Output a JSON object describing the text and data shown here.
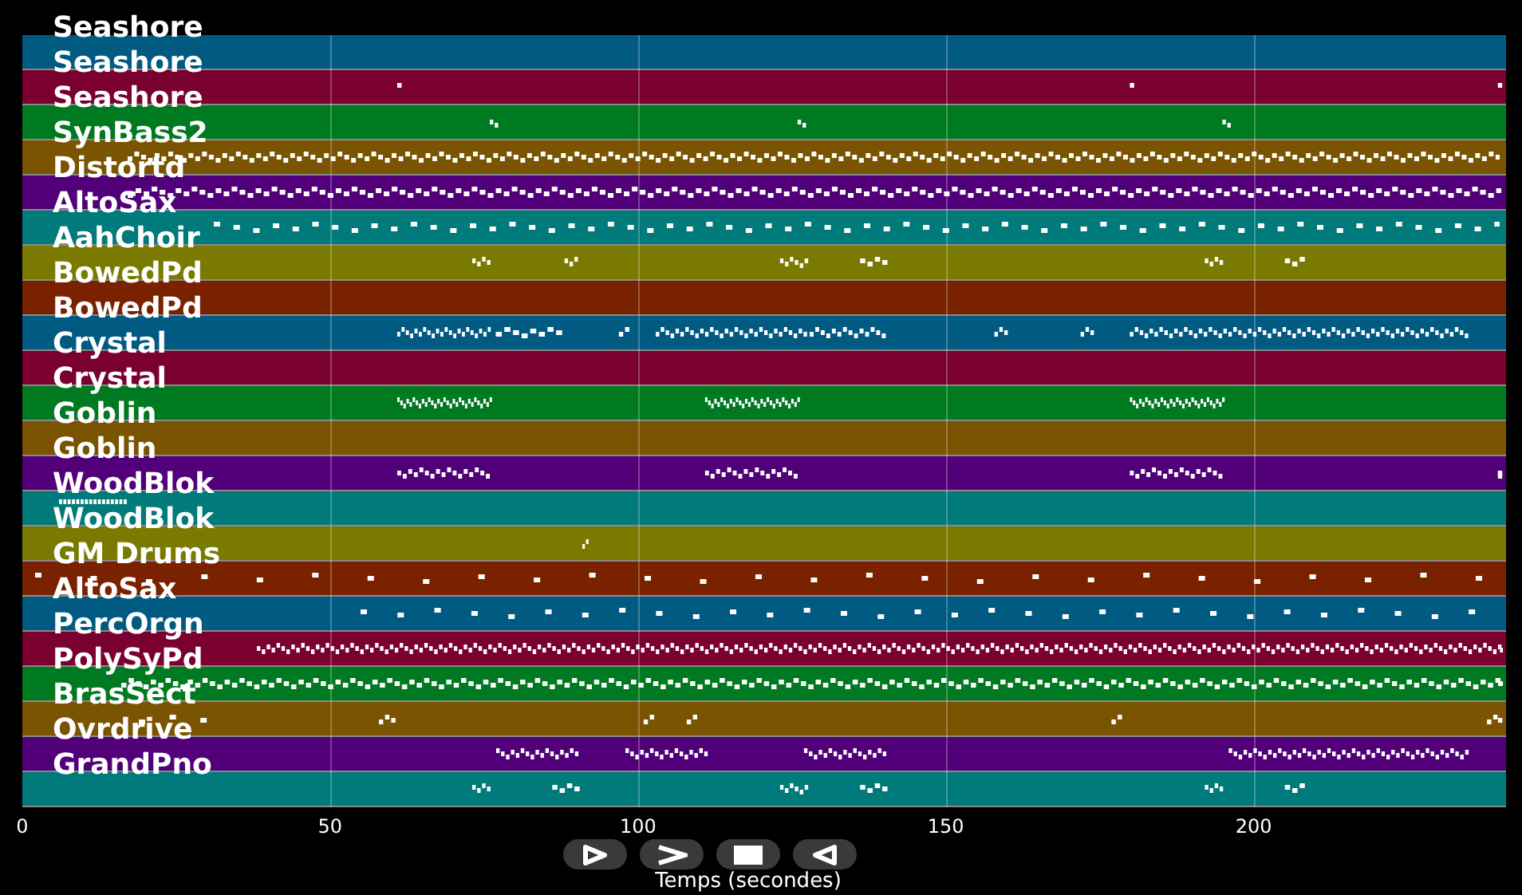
{
  "tracks": [
    {
      "name": "Seashore",
      "color": "#005a82"
    },
    {
      "name": "Seashore",
      "color": "#7a0030"
    },
    {
      "name": "Seashore",
      "color": "#007a20"
    },
    {
      "name": "SynBass2",
      "color": "#7a5400"
    },
    {
      "name": "Distortd",
      "color": "#52007a"
    },
    {
      "name": "AltoSax",
      "color": "#007a7a"
    },
    {
      "name": "AahChoir",
      "color": "#7a7a00"
    },
    {
      "name": "BowedPd",
      "color": "#7a2200"
    },
    {
      "name": "BowedPd",
      "color": "#005a82"
    },
    {
      "name": "Crystal",
      "color": "#7a0030"
    },
    {
      "name": "Crystal",
      "color": "#007a20"
    },
    {
      "name": "Goblin",
      "color": "#7a5400"
    },
    {
      "name": "Goblin",
      "color": "#52007a"
    },
    {
      "name": "WoodBlok",
      "color": "#007a7a"
    },
    {
      "name": "WoodBlok",
      "color": "#7a7a00"
    },
    {
      "name": "GM Drums",
      "color": "#7a2200"
    },
    {
      "name": "AltoSax",
      "color": "#005a82"
    },
    {
      "name": "PercOrgn",
      "color": "#7a0030"
    },
    {
      "name": "PolySyPd",
      "color": "#007a20"
    },
    {
      "name": "BrasSect",
      "color": "#7a5400"
    },
    {
      "name": "Ovrdrive",
      "color": "#52007a"
    },
    {
      "name": "GrandPno",
      "color": "#007a7a"
    }
  ],
  "x_axis": {
    "ticks": [
      "0",
      "50",
      "100",
      "150",
      "200"
    ],
    "label": "Temps (secondes)"
  },
  "controls": [
    {
      "kind": "play"
    },
    {
      "kind": "forward"
    },
    {
      "kind": "stop"
    },
    {
      "kind": "rewind"
    }
  ]
}
